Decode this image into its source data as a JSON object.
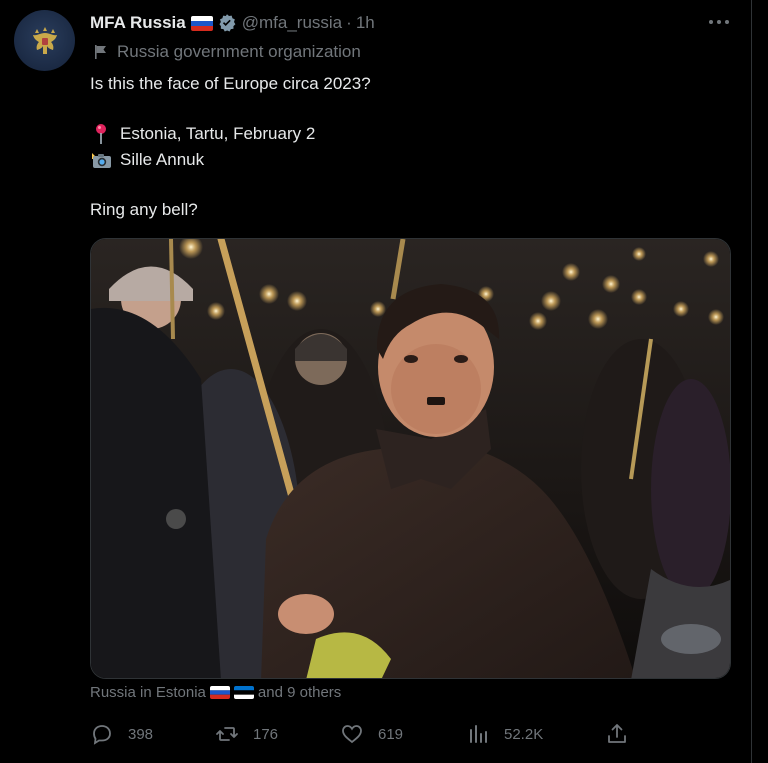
{
  "author": {
    "name": "MFA Russia",
    "handle": "@mfa_russia",
    "separator": "·",
    "time": "1h",
    "affiliation": "Russia government organization"
  },
  "tweet": {
    "line1": "Is this the face of Europe circa 2023?",
    "location": "Estonia, Tartu, February 2",
    "photographer": "Sille Annuk",
    "closing": "Ring any bell?"
  },
  "media": {
    "tagged": "Russia in Estonia",
    "tagged_more": "and 9 others"
  },
  "actions": {
    "replies": "398",
    "retweets": "176",
    "likes": "619",
    "views": "52.2K"
  },
  "icons": {
    "avatar": "coat-of-arms-icon",
    "verified": "verified-badge-icon",
    "more": "more-icon",
    "affiliation": "flag-icon",
    "location": "pin-icon",
    "camera": "camera-flash-icon",
    "reply": "reply-icon",
    "retweet": "retweet-icon",
    "like": "heart-icon",
    "views": "views-icon",
    "share": "share-icon"
  },
  "colors": {
    "background": "#000000",
    "text": "#e7e9ea",
    "muted": "#71767b",
    "verified_badge": "#829aab",
    "divider": "#2f3336"
  }
}
